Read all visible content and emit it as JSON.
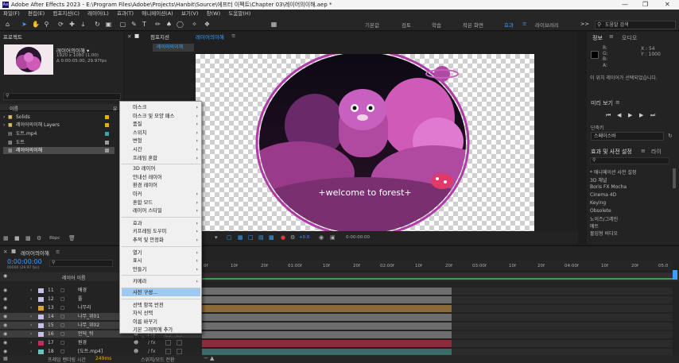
{
  "window": {
    "title": "Adobe After Effects 2023 - E:\\Program Files\\Adobe\\Projects\\Hanbit\\Source\\에프터 이펙트\\Chapter 03\\레이어의이해.aep *",
    "app_icon": "Ae"
  },
  "menubar": [
    "파일(F)",
    "편집(E)",
    "컴포지션(C)",
    "레이어(L)",
    "효과(T)",
    "애니메이션(A)",
    "보기(V)",
    "창(W)",
    "도움말(H)"
  ],
  "workspaces": {
    "items": [
      "기본값",
      "검토",
      "학습",
      "작은 화면",
      "라이브러리"
    ],
    "active": "효과",
    "more": ">>"
  },
  "search_help": {
    "placeholder": "도움말 검색"
  },
  "project": {
    "tab": "프로젝트",
    "comp_name": "레이어의이해 ▾",
    "comp_size": "1920 x 1080 (1.00)",
    "comp_duration": "Δ 0:00:05:00, 29.97fps",
    "col_name": "이름",
    "col_type": "유",
    "items": [
      {
        "label": "Solids",
        "swatch": "#e5b000"
      },
      {
        "label": "레이어의이해 Layers",
        "swatch": "#e5b000"
      },
      {
        "label": "도트.mp4",
        "swatch": "#3ba4b0"
      },
      {
        "label": "도트",
        "swatch": "#9b9b9b"
      },
      {
        "label": "레이어의이해",
        "swatch": "#9b9b9b"
      }
    ],
    "bpc": "8bpc"
  },
  "comp_panel": {
    "tab": "컴포지션",
    "tab_name": "레이어의이해",
    "flow_tab": "레이어의이해",
    "canvas_text": "+welcome to forest+",
    "timecode": "0:00:00:00",
    "zoom_value": "+0.0"
  },
  "info_panel": {
    "tab": "정보",
    "tab2": "오디오",
    "r": "R:",
    "g": "G:",
    "b": "B:",
    "a": "A:",
    "x": "X : 54",
    "y": "Y : 1000",
    "message": "이 위치 레이어가 선택되었습니다."
  },
  "preview_panel": {
    "tab": "미리 보기",
    "shortcut_label": "단축키",
    "shortcut_value": "스페이스바"
  },
  "effects_panel": {
    "tab": "효과 및 사전 설정",
    "tab2": "라이",
    "items": [
      "* 애니메이션 사전 설정",
      "3D 채널",
      "Boris FX Mocha",
      "Cinema 4D",
      "Keying",
      "Obsolete",
      "노이즈/그레인",
      "매트",
      "몰입형 비디오"
    ]
  },
  "timeline": {
    "tab": "레이어의이해",
    "timecode": "0:00:00:00",
    "fps": "00000 (29.97 fps)",
    "col_layer_name": "레이어 이름",
    "layers": [
      {
        "num": "11",
        "name": "배경",
        "swatch": "#c8c0e8",
        "sel": false,
        "bar_end": 0.75,
        "bar_color": "#6d6d6d"
      },
      {
        "num": "12",
        "name": "풀",
        "swatch": "#c8c0e8",
        "sel": false,
        "bar_end": 0.75,
        "bar_color": "#6d6d6d"
      },
      {
        "num": "13",
        "name": "나무리",
        "swatch": "#e0a030",
        "sel": false,
        "bar_end": 0.75,
        "bar_color": "#8a6a3a"
      },
      {
        "num": "14",
        "name": "나무_위01",
        "swatch": "#c8c0e8",
        "sel": true,
        "bar_end": 0.75,
        "bar_color": "#6d6d6d"
      },
      {
        "num": "15",
        "name": "나무_위02",
        "swatch": "#c8c0e8",
        "sel": true,
        "bar_end": 0.75,
        "bar_color": "#6d6d6d"
      },
      {
        "num": "16",
        "name": "언덕_뒤",
        "swatch": "#c8c0e8",
        "sel": true,
        "bar_end": 0.75,
        "bar_color": "#6d6d6d"
      },
      {
        "num": "17",
        "name": "원경",
        "swatch": "#c0305a",
        "sel": false,
        "bar_end": 0.75,
        "bar_color": "#8a2c3a"
      },
      {
        "num": "18",
        "name": "[도트.mp4]",
        "swatch": "#70c0c0",
        "sel": false,
        "bar_end": 0.75,
        "bar_color": "#3a6a6a"
      }
    ],
    "ruler": [
      "0f",
      "10f",
      "20f",
      "01:00f",
      "10f",
      "20f",
      "02:00f",
      "10f",
      "20f",
      "03:00f",
      "10f",
      "20f",
      "04:00f",
      "10f",
      "20f",
      "05:0"
    ],
    "render_time_label": "프레임 렌더링 시간",
    "render_time_value": "249ms",
    "switch_mode": "스위치/모드 전환"
  },
  "context_menu": {
    "items": [
      {
        "label": "마스크",
        "sub": true
      },
      {
        "label": "마스크 및 모양 패스",
        "sub": true
      },
      {
        "label": "품질",
        "sub": true
      },
      {
        "label": "스위치",
        "sub": true
      },
      {
        "label": "변형",
        "sub": true
      },
      {
        "label": "시간",
        "sub": true
      },
      {
        "label": "프레임 혼합",
        "sub": true
      },
      {
        "label": "3D 레이어",
        "sub": false
      },
      {
        "label": "안내선 레이어",
        "sub": false
      },
      {
        "label": "환경 레이어",
        "sub": false
      },
      {
        "label": "마커",
        "sub": true
      },
      {
        "label": "혼합 모드",
        "sub": true
      },
      {
        "label": "레이어 스타일",
        "sub": true
      },
      {
        "label": "효과",
        "sub": true
      },
      {
        "label": "키프레임 도우미",
        "sub": true
      },
      {
        "label": "추적 및 안정화",
        "sub": true
      },
      {
        "label": "열기",
        "sub": true
      },
      {
        "label": "표시",
        "sub": true
      },
      {
        "label": "만들기",
        "sub": true
      },
      {
        "label": "카메라",
        "sub": true
      },
      {
        "label": "사전 구성...",
        "sub": false
      },
      {
        "label": "선택 항목 반전",
        "sub": false
      },
      {
        "label": "자식 선택",
        "sub": false
      },
      {
        "label": "이름 바꾸기",
        "sub": false
      },
      {
        "label": "기본 그래픽에 추가",
        "sub": false
      },
      {
        "label": "장면 편집 감지...",
        "sub": false
      }
    ],
    "highlighted": "사전 구성..."
  }
}
